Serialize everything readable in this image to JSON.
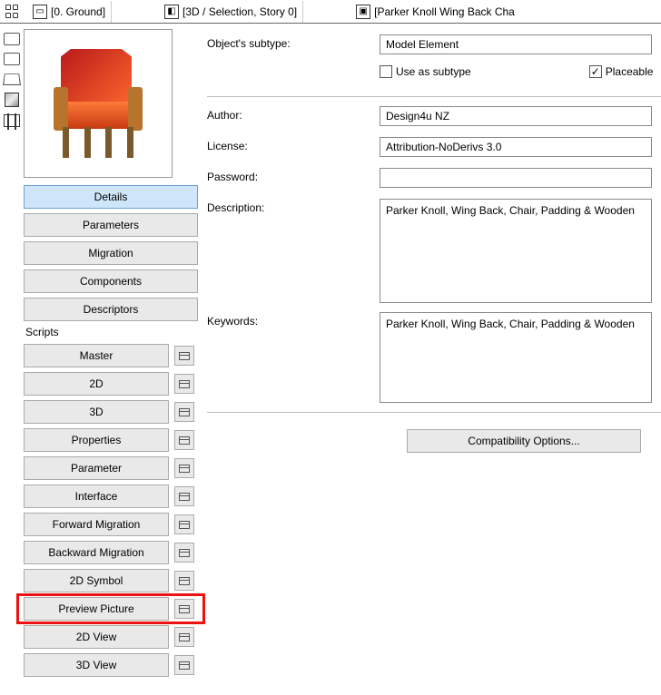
{
  "topbar": {
    "tab1": "[0. Ground]",
    "tab2": "[3D / Selection, Story 0]",
    "tab3": "[Parker Knoll Wing Back Cha"
  },
  "left": {
    "nav": [
      "Details",
      "Parameters",
      "Migration",
      "Components",
      "Descriptors"
    ],
    "nav_selected": 0,
    "scripts_label": "Scripts",
    "scripts": [
      "Master",
      "2D",
      "3D",
      "Properties",
      "Parameter",
      "Interface",
      "Forward Migration",
      "Backward Migration",
      "2D Symbol",
      "Preview Picture",
      "2D View",
      "3D View"
    ],
    "highlight_index": 9
  },
  "right": {
    "subtype_label": "Object's subtype:",
    "subtype_value": "Model Element",
    "use_as_subtype_label": "Use as subtype",
    "use_as_subtype_checked": false,
    "placeable_label": "Placeable",
    "placeable_checked": true,
    "author_label": "Author:",
    "author_value": "Design4u NZ",
    "license_label": "License:",
    "license_value": "Attribution-NoDerivs 3.0",
    "password_label": "Password:",
    "password_value": "",
    "description_label": "Description:",
    "description_value": "Parker Knoll, Wing Back, Chair, Padding & Wooden",
    "keywords_label": "Keywords:",
    "keywords_value": "Parker Knoll, Wing Back, Chair, Padding & Wooden",
    "compat_btn": "Compatibility Options..."
  }
}
